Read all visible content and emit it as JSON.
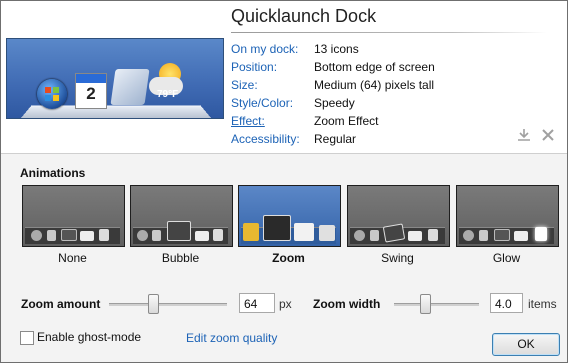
{
  "title": "Quicklaunch Dock",
  "preview": {
    "calendar_day": "2",
    "weather_temp": "79°F"
  },
  "info": [
    {
      "label": "On my dock:",
      "value": "13 icons",
      "link": false
    },
    {
      "label": "Position:",
      "value": "Bottom edge of screen",
      "link": false
    },
    {
      "label": "Size:",
      "value": "Medium (64) pixels tall",
      "link": false
    },
    {
      "label": "Style/Color:",
      "value": "Speedy",
      "link": false
    },
    {
      "label": "Effect:",
      "value": "Zoom Effect",
      "link": true
    },
    {
      "label": "Accessibility:",
      "value": "Regular",
      "link": false
    }
  ],
  "actions": {
    "download_icon": "download-icon",
    "remove_icon": "close-icon"
  },
  "animations": {
    "heading": "Animations",
    "options": [
      {
        "label": "None",
        "selected": false
      },
      {
        "label": "Bubble",
        "selected": false
      },
      {
        "label": "Zoom",
        "selected": true
      },
      {
        "label": "Swing",
        "selected": false
      },
      {
        "label": "Glow",
        "selected": false
      }
    ]
  },
  "zoom_amount": {
    "label": "Zoom amount",
    "value": "64",
    "unit": "px",
    "level": 0.37
  },
  "zoom_width": {
    "label": "Zoom width",
    "value": "4.0",
    "unit": "items",
    "level": 0.36
  },
  "ghost_mode": {
    "label": "Enable ghost-mode",
    "checked": false
  },
  "edit_zoom_link": "Edit zoom quality",
  "ok_label": "OK",
  "colors": {
    "link": "#1d63b6",
    "selected_thumb": "#3463a8"
  }
}
